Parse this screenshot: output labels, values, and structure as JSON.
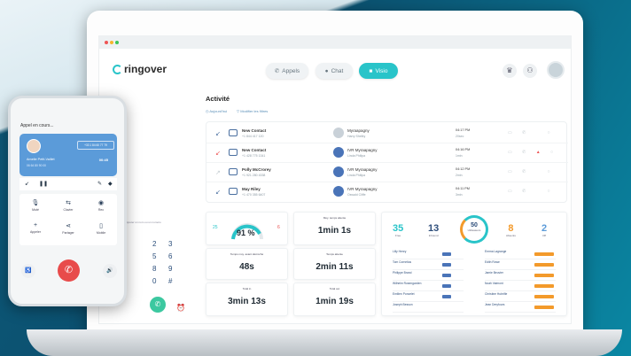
{
  "colors": {
    "accent": "#29c4c9",
    "primary_blue": "#5b9bd9",
    "hangup_red": "#e84b4b"
  },
  "app": {
    "brand": "ringover"
  },
  "nav": {
    "calls_label": "Appels",
    "chat_label": "Chat",
    "visio_label": "Visio"
  },
  "activity": {
    "title": "Activité",
    "filters": [
      "Aujourd'hui",
      "Modifier les filtres"
    ],
    "rows": [
      {
        "contact": "New Contact",
        "number": "+1 844 417 120",
        "agent": "Myraapagny",
        "agent_sub": "Harry Shelby",
        "time": "04:17 PM",
        "duration": "20sec"
      },
      {
        "contact": "New Contact",
        "number": "+1 428 775 1341",
        "agent": "IVR Myraapagny",
        "agent_sub": "Linda Philipa",
        "time": "04:16 PM",
        "duration": "1min"
      },
      {
        "contact": "Polly McCrorey",
        "number": "+1 921 280 4338",
        "agent": "IVR Myraapagny",
        "agent_sub": "Linda Philipa",
        "time": "04:12 PM",
        "duration": "2min"
      },
      {
        "contact": "May Riley",
        "number": "+1 470 355 6407",
        "agent": "IVR Myraapagny",
        "agent_sub": "Oswald Cliffe",
        "time": "04:11 PM",
        "duration": "3min"
      }
    ]
  },
  "stats": {
    "gauge": {
      "value": "91 %",
      "left": "25",
      "right": "6"
    },
    "cards": [
      {
        "label": "Moy. temps attente",
        "value": "1min 1s"
      },
      {
        "label": "Temps moy. avant décroché",
        "value": "48s"
      },
      {
        "label": "Temps attente",
        "value": "2min 11s"
      },
      {
        "label": "Total in",
        "value": "3min 13s"
      },
      {
        "label": "Total out",
        "value": "1min 19s"
      }
    ]
  },
  "kpis": [
    {
      "value": "35",
      "label": "Free",
      "color": "#29c4c9"
    },
    {
      "value": "13",
      "label": "Inbound",
      "color": "#2d4d7a"
    },
    {
      "value": "50",
      "label": "Utilisateurs",
      "color": "#2d4d7a"
    },
    {
      "value": "8",
      "label": "Absents",
      "color": "#f39a2b"
    },
    {
      "value": "2",
      "label": "Off",
      "color": "#5b9bd9"
    }
  ],
  "user_list_left": [
    "Lilly Henry",
    "Tom Cornelius",
    "Philippe Brand",
    "Wilhelm Rosengarden",
    "Emilien Poncelet",
    "Joseph Besson"
  ],
  "user_list_right": [
    "Emma Lagrange",
    "Edith Rowe",
    "Jamie Beuvier",
    "Noah Valmont",
    "Christine Hubrifle",
    "Jean Dreyfours"
  ],
  "dialpad": [
    "2",
    "3",
    "5",
    "6",
    "8",
    "9",
    "0",
    "#"
  ],
  "phone": {
    "title": "Appel en cours...",
    "number_button": "+33 1 84 60 77 79",
    "caller_name": "Amelie Petit-Vaillet",
    "caller_sub": "06 64 80 90 00",
    "timer": "00:45",
    "actions": [
      {
        "icon": "mute-icon",
        "glyph": "🎙",
        "label": "Muté"
      },
      {
        "icon": "transfer-icon",
        "glyph": "⇆",
        "label": "Clavier"
      },
      {
        "icon": "record-icon",
        "glyph": "◉",
        "label": "Rec"
      },
      {
        "icon": "add-icon",
        "glyph": "+",
        "label": "Appeler"
      },
      {
        "icon": "share-icon",
        "glyph": "⋖",
        "label": "Partager"
      },
      {
        "icon": "mobile-icon",
        "glyph": "▯",
        "label": "Mobile"
      }
    ]
  }
}
